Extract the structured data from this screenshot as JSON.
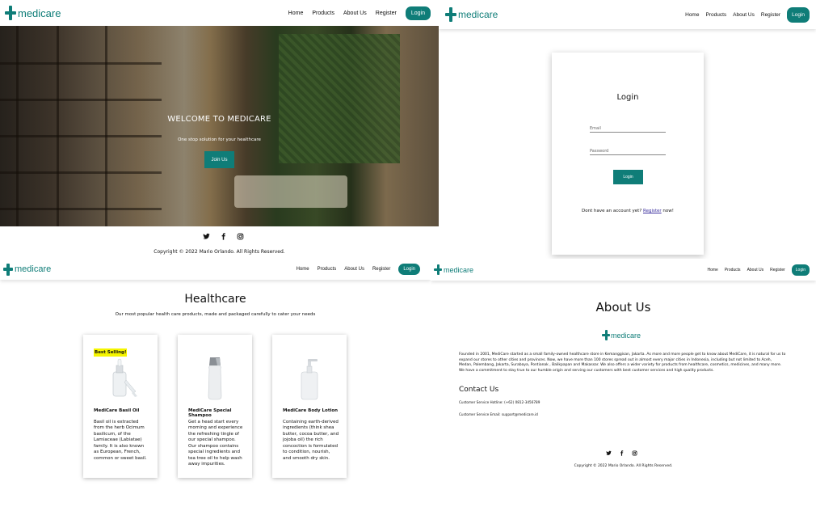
{
  "brand": {
    "name": "medicare",
    "color": "#0f7d78"
  },
  "nav": {
    "links": [
      "Home",
      "Products",
      "About Us",
      "Register"
    ],
    "login_label": "Login"
  },
  "hero": {
    "title": "WELCOME TO MEDICARE",
    "subtitle": "One stop solution for your healthcare",
    "join_label": "Join Us"
  },
  "footer": {
    "icons": [
      "twitter-icon",
      "facebook-icon",
      "instagram-icon"
    ],
    "copyright": "Copyright © 2022 Mario Orlando. All Rights Reserved."
  },
  "login_page": {
    "title": "Login",
    "email_placeholder": "Email",
    "password_placeholder": "Password",
    "submit_label": "Login",
    "register_prefix": "Dont have an account yet?",
    "register_link": "Register",
    "register_suffix": "now!"
  },
  "products_page": {
    "title": "Healthcare",
    "subtitle": "Our most popular health care products, made and packaged carefully to cater your needs",
    "badge": "Best Selling!",
    "products": [
      {
        "name": "MediCare Basil Oil",
        "description": "Basil oil is extracted from the herb Ocimum basilicum, of the Lamiaceae (Labiatae) family. It is also known as European, French, common or sweet basil."
      },
      {
        "name": "MediCare Special Shampoo",
        "description": "Get a head start every morning and experience the refreshing tingle of our special shampoo. Our shampoo contains special ingredients and tea tree oil to help wash away impurities."
      },
      {
        "name": "MediCare Body Lotion",
        "description": "Containing earth-derived ingredients (think shea butter, cocoa butter, and jojoba oil) the rich concoction is formulated to condition, nourish, and smooth dry skin."
      }
    ]
  },
  "about_page": {
    "title": "About Us",
    "text": "Founded in 2001, MediCare started as a small family-owned healthcare store in Kemanggisan, Jakarta. As more and more people get to know about MediCare, it is natural for us to expand our stores to other cities and provinces. Now, we have more than 100 stores spread out in almost every major cities in Indonesia, including but not limited to Aceh, Medan, Palembang, Jakarta, Surabaya, Pontianak , Balikpapan and Makassar. We also offers a wider variety for products from healthcare, cosmetics, medicines, and many more. We have a commitment to stay true to our humble origin and serving our customers with best customer services and high quality products.",
    "contact_title": "Contact Us",
    "hotline": "Customer Service Hotline: (+62) 0812-3456789",
    "email": "Customer Service Email: support@medicare.id"
  }
}
